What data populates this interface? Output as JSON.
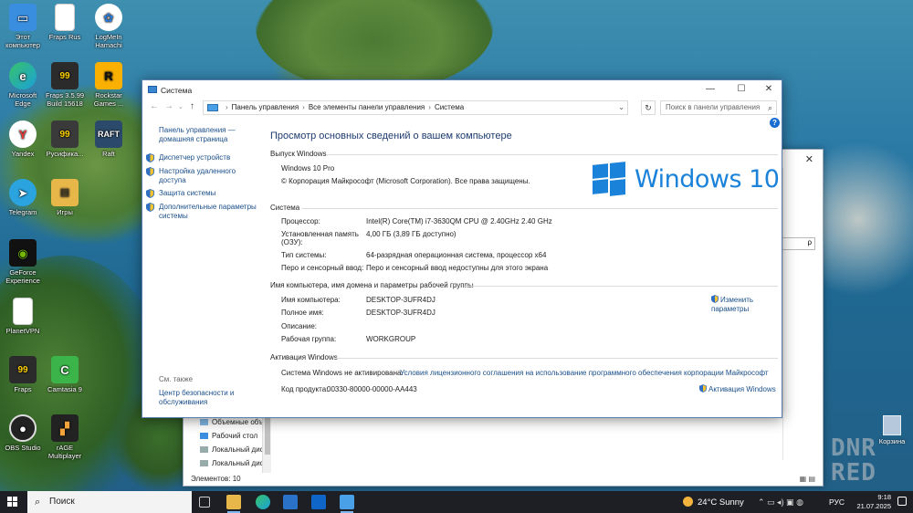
{
  "desktop": {
    "icons": [
      {
        "label": "Этот компьютер",
        "icon": "this-pc-icon",
        "color": "#3a8ee0"
      },
      {
        "label": "Microsoft Edge",
        "icon": "edge-icon",
        "color": "#1ba0d8"
      },
      {
        "label": "Yandex",
        "icon": "yandex-icon",
        "color": "#e53935"
      },
      {
        "label": "Telegram",
        "icon": "telegram-icon",
        "color": "#2aa3df"
      },
      {
        "label": "GeForce Experience",
        "icon": "geforce-icon",
        "color": "#111111"
      },
      {
        "label": "PlanetVPN",
        "icon": "file-icon",
        "color": "#ffffff"
      },
      {
        "label": "Fraps",
        "icon": "fraps-icon",
        "color": "#2b2b2b"
      },
      {
        "label": "OBS Studio",
        "icon": "obs-icon",
        "color": "#222222"
      },
      {
        "label": "Fraps Rus",
        "icon": "file-icon",
        "color": "#ffffff"
      },
      {
        "label": "Fraps 3.5.99 Build 15618",
        "icon": "fraps-icon",
        "color": "#2b2b2b"
      },
      {
        "label": "Русифика...",
        "icon": "monitor-icon",
        "color": "#2b2b2b"
      },
      {
        "label": "Игры",
        "icon": "folder-icon",
        "color": "#e8b74a"
      },
      {
        "label": "Camtasia 9",
        "icon": "camtasia-icon",
        "color": "#3bb54a"
      },
      {
        "label": "rAGE Multiplayer",
        "icon": "rage-icon",
        "color": "#222222"
      },
      {
        "label": "LogMeIn Hamachi",
        "icon": "hamachi-icon",
        "color": "#ffffff"
      },
      {
        "label": "Rockstar Games ...",
        "icon": "rockstar-icon",
        "color": "#f9b000"
      },
      {
        "label": "Raft",
        "icon": "raft-icon",
        "color": "#2b4a6b"
      }
    ],
    "recycle_bin": "Корзина",
    "watermark": "DNR RED"
  },
  "explorer_bg": {
    "nav_items": [
      {
        "label": "Объемные объе",
        "icon": "3d-objects-icon"
      },
      {
        "label": "Рабочий стол",
        "icon": "desktop-folder-icon"
      },
      {
        "label": "Локальный дис",
        "icon": "drive-icon"
      },
      {
        "label": "Локальный дис",
        "icon": "drive-icon"
      }
    ],
    "status": "Элементов: 10",
    "search_glyph": "ρ"
  },
  "window": {
    "title": "Система",
    "breadcrumb": [
      "Панель управления",
      "Все элементы панели управления",
      "Система"
    ],
    "search_placeholder": "Поиск в панели управления",
    "controls": {
      "minimize": "—",
      "maximize": "☐",
      "close": "✕"
    }
  },
  "left_pane": {
    "home": "Панель управления — домашняя страница",
    "links": [
      "Диспетчер устройств",
      "Настройка удаленного доступа",
      "Защита системы",
      "Дополнительные параметры системы"
    ],
    "see_also": "См. также",
    "see_also_links": [
      "Центр безопасности и обслуживания"
    ]
  },
  "main": {
    "heading": "Просмотр основных сведений о вашем компьютере",
    "edition": {
      "section": "Выпуск Windows",
      "name": "Windows 10 Pro",
      "copyright": "© Корпорация Майкрософт (Microsoft Corporation). Все права защищены.",
      "logo_text": "Windows 10"
    },
    "system": {
      "section": "Система",
      "rows": [
        {
          "label": "Процессор:",
          "value": "Intel(R) Core(TM) i7-3630QM CPU @ 2.40GHz   2.40 GHz"
        },
        {
          "label": "Установленная память (ОЗУ):",
          "value": "4,00 ГБ (3,89 ГБ доступно)"
        },
        {
          "label": "Тип системы:",
          "value": "64-разрядная операционная система, процессор x64"
        },
        {
          "label": "Перо и сенсорный ввод:",
          "value": "Перо и сенсорный ввод недоступны для этого экрана"
        }
      ]
    },
    "computer": {
      "section": "Имя компьютера, имя домена и параметры рабочей группы",
      "rows": [
        {
          "label": "Имя компьютера:",
          "value": "DESKTOP-3UFR4DJ"
        },
        {
          "label": "Полное имя:",
          "value": "DESKTOP-3UFR4DJ"
        },
        {
          "label": "Описание:",
          "value": ""
        },
        {
          "label": "Рабочая группа:",
          "value": "WORKGROUP"
        }
      ],
      "change_link": "Изменить параметры"
    },
    "activation": {
      "section": "Активация Windows",
      "status": "Система Windows не активирована.",
      "license_link": "Условия лицензионного соглашения на использование программного обеспечения корпорации Майкрософт",
      "product_label": "Код продукта:",
      "product_key": "00330-80000-00000-AA443",
      "activate_link": "Активация Windows"
    }
  },
  "taskbar": {
    "search": "Поиск",
    "weather": "24°C  Sunny",
    "lang": "РУС",
    "time": "9:18",
    "date": "21.07.2025",
    "accent": "#1d1f24"
  }
}
